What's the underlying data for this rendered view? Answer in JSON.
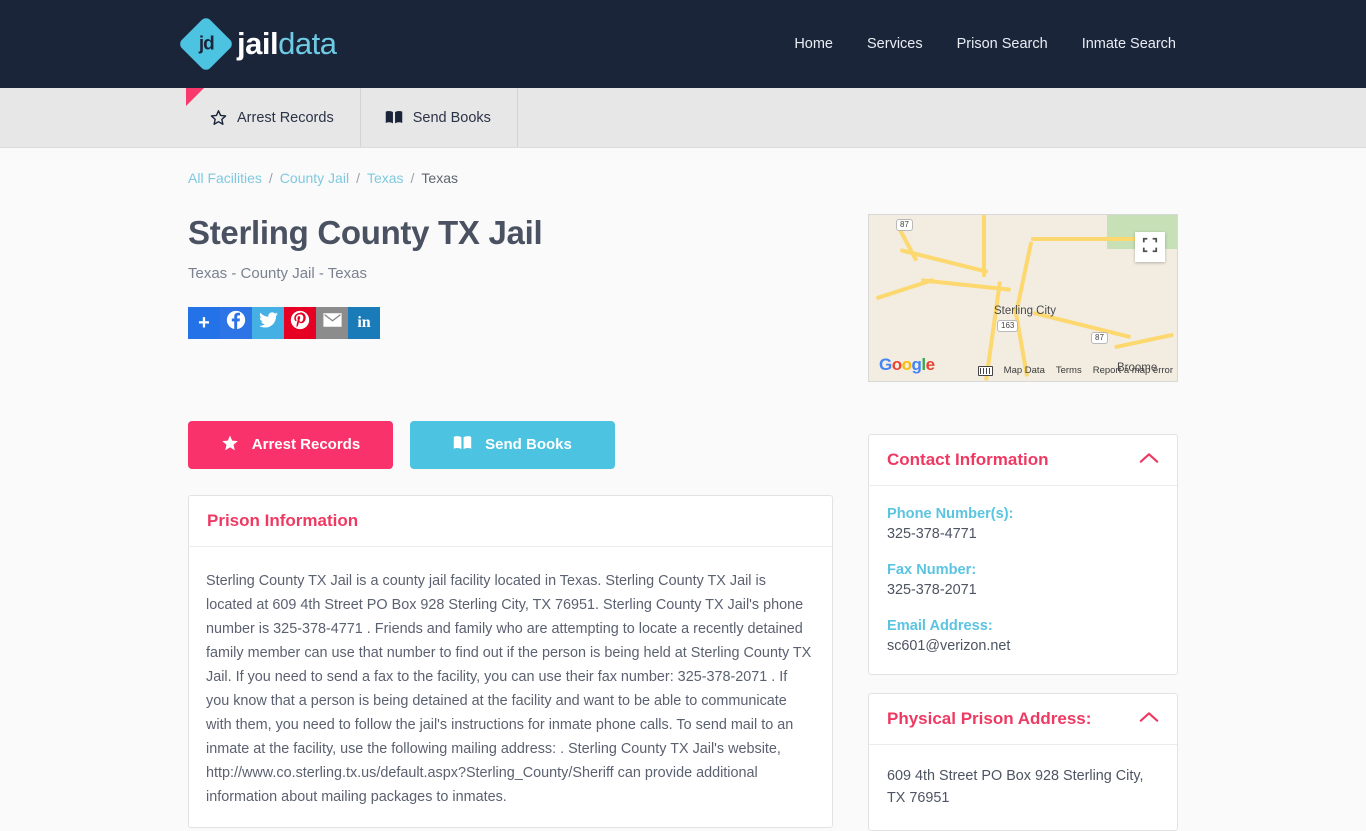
{
  "header": {
    "logo_initials": "jd",
    "logo_word_1": "jail",
    "logo_word_2": "data",
    "nav": [
      {
        "label": "Home"
      },
      {
        "label": "Services"
      },
      {
        "label": "Prison Search"
      },
      {
        "label": "Inmate Search"
      }
    ]
  },
  "tabs": [
    {
      "label": "Arrest Records",
      "icon": "star-icon"
    },
    {
      "label": "Send Books",
      "icon": "book-icon"
    }
  ],
  "breadcrumb": {
    "items": [
      {
        "label": "All Facilities",
        "link": true
      },
      {
        "label": "County Jail",
        "link": true
      },
      {
        "label": "Texas",
        "link": true
      },
      {
        "label": "Texas",
        "link": false
      }
    ],
    "separator": "/"
  },
  "facility": {
    "title": "Sterling County TX Jail",
    "subtitle": "Texas - County Jail - Texas"
  },
  "share": {
    "buttons": [
      {
        "name": "addthis",
        "icon": "plus-icon",
        "glyph": "+",
        "color": "#2472e8"
      },
      {
        "name": "facebook",
        "icon": "facebook-icon",
        "glyph": "f",
        "color": "#2d74e6"
      },
      {
        "name": "twitter",
        "icon": "twitter-icon",
        "glyph": "t",
        "color": "#45b0e3"
      },
      {
        "name": "pinterest",
        "icon": "pinterest-icon",
        "glyph": "p",
        "color": "#e60023"
      },
      {
        "name": "email",
        "icon": "email-icon",
        "glyph": "✉",
        "color": "#8c8c8c"
      },
      {
        "name": "linkedin",
        "icon": "linkedin-icon",
        "glyph": "in",
        "color": "#1a7bb9"
      }
    ]
  },
  "actions": {
    "arrest_records": "Arrest Records",
    "send_books": "Send Books"
  },
  "prison_information": {
    "heading": "Prison Information",
    "body": "Sterling County TX Jail is a county jail facility located in Texas. Sterling County TX Jail is located at 609 4th Street PO Box 928 Sterling City, TX 76951. Sterling County TX Jail's phone number is 325-378-4771 . Friends and family who are attempting to locate a recently detained family member can use that number to find out if the person is being held at Sterling County TX Jail. If you need to send a fax to the facility, you can use their fax number: 325-378-2071 . If you know that a person is being detained at the facility and want to be able to communicate with them, you need to follow the jail's instructions for inmate phone calls. To send mail to an inmate at the facility, use the following mailing address: . Sterling County TX Jail's website, http://www.co.sterling.tx.us/default.aspx?Sterling_County/Sheriff can provide additional information about mailing packages to inmates."
  },
  "contact_information": {
    "heading": "Contact Information",
    "phone_label": "Phone Number(s):",
    "phone_value": "325-378-4771",
    "fax_label": "Fax Number:",
    "fax_value": "325-378-2071",
    "email_label": "Email Address:",
    "email_value": "sc601@verizon.net"
  },
  "physical_address": {
    "heading": "Physical Prison Address:",
    "value": "609 4th Street PO Box 928 Sterling City, TX 76951"
  },
  "map": {
    "city_label": "Sterling City",
    "town_label": "Broome",
    "route_1": "87",
    "route_2": "163",
    "route_3": "87",
    "provider": "Google",
    "provider_letters": [
      "G",
      "o",
      "o",
      "g",
      "l",
      "e"
    ],
    "map_data": "Map Data",
    "terms": "Terms",
    "report": "Report a map error"
  },
  "colors": {
    "header_bg": "#1b253a",
    "accent_pink": "#f9326b",
    "accent_cyan": "#4cc3e0",
    "panel_title_pink": "#ee3a63",
    "label_cyan": "#5bc4e0"
  }
}
